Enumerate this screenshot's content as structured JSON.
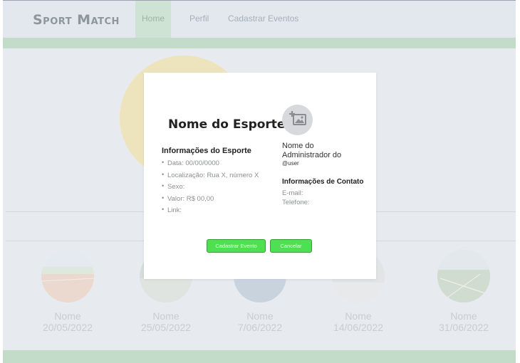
{
  "navbar": {
    "brand": "Sport Match",
    "items": [
      {
        "label": "Home"
      },
      {
        "label": "Perfil"
      },
      {
        "label": "Cadastrar Eventos"
      }
    ]
  },
  "events": [
    {
      "name": "Nome",
      "date": "20/05/2022"
    },
    {
      "name": "Nome",
      "date": "25/05/2022"
    },
    {
      "name": "Nome",
      "date": "7/06/2022"
    },
    {
      "name": "Nome",
      "date": "14/06/2022"
    },
    {
      "name": "Nome",
      "date": "31/06/2022"
    }
  ],
  "modal": {
    "title": "Nome do Esporte",
    "sport_info_title": "Informações do Esporte",
    "sport_info": [
      "Data: 00/00/0000",
      "Localização: Rua X, número X",
      "Sexo:",
      "Valor: R$ 00,00",
      "Link:"
    ],
    "admin_name_line1": "Nome do",
    "admin_name_line2": "Administrador do",
    "admin_user": "@user",
    "contact_title": "Informações de Contato",
    "email_label": "E-mail:",
    "phone_label": "Telefone:",
    "save_button": "Cadastrar Evento",
    "cancel_button": "Cancelar",
    "avatar_icon": "add-image-icon"
  },
  "colors": {
    "accent_green": "#4fe051",
    "strip_green": "#c3dbc9",
    "hero_circle": "#ede3bd"
  }
}
